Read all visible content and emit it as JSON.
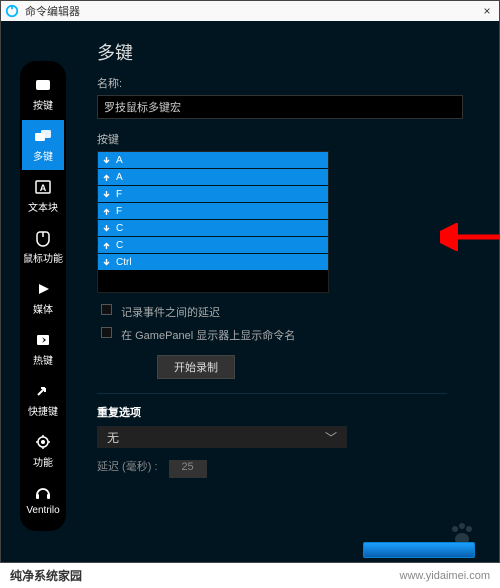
{
  "window": {
    "title": "命令编辑器",
    "close_icon": "×"
  },
  "sidebar": {
    "items": [
      {
        "id": "keys",
        "label": "按键"
      },
      {
        "id": "multikey",
        "label": "多键"
      },
      {
        "id": "text",
        "label": "文本块"
      },
      {
        "id": "mouse",
        "label": "鼠标功能"
      },
      {
        "id": "media",
        "label": "媒体"
      },
      {
        "id": "hotkey",
        "label": "热键"
      },
      {
        "id": "shortcut",
        "label": "快捷键"
      },
      {
        "id": "function",
        "label": "功能"
      },
      {
        "id": "ventrilo",
        "label": "Ventrilo"
      }
    ],
    "active": "multikey"
  },
  "main": {
    "heading": "多键",
    "name_label": "名称:",
    "name_value": "罗技鼠标多键宏",
    "keys_label": "按键",
    "key_rows": [
      {
        "dir": "down",
        "key": "A"
      },
      {
        "dir": "up",
        "key": "A"
      },
      {
        "dir": "down",
        "key": "F"
      },
      {
        "dir": "up",
        "key": "F"
      },
      {
        "dir": "down",
        "key": "C"
      },
      {
        "dir": "up",
        "key": "C"
      },
      {
        "dir": "down",
        "key": "Ctrl"
      }
    ],
    "record_delay_label": "记录事件之间的延迟",
    "show_gamepanel_label": "在 GamePanel 显示器上显示命令名",
    "start_record_btn": "开始录制",
    "repeat_heading": "重复选项",
    "repeat_value": "无",
    "delay_label": "延迟 (毫秒) :",
    "delay_value": "25"
  },
  "watermark": {
    "brand": "纯净系统家园",
    "url": "www.yidaimei.com"
  }
}
